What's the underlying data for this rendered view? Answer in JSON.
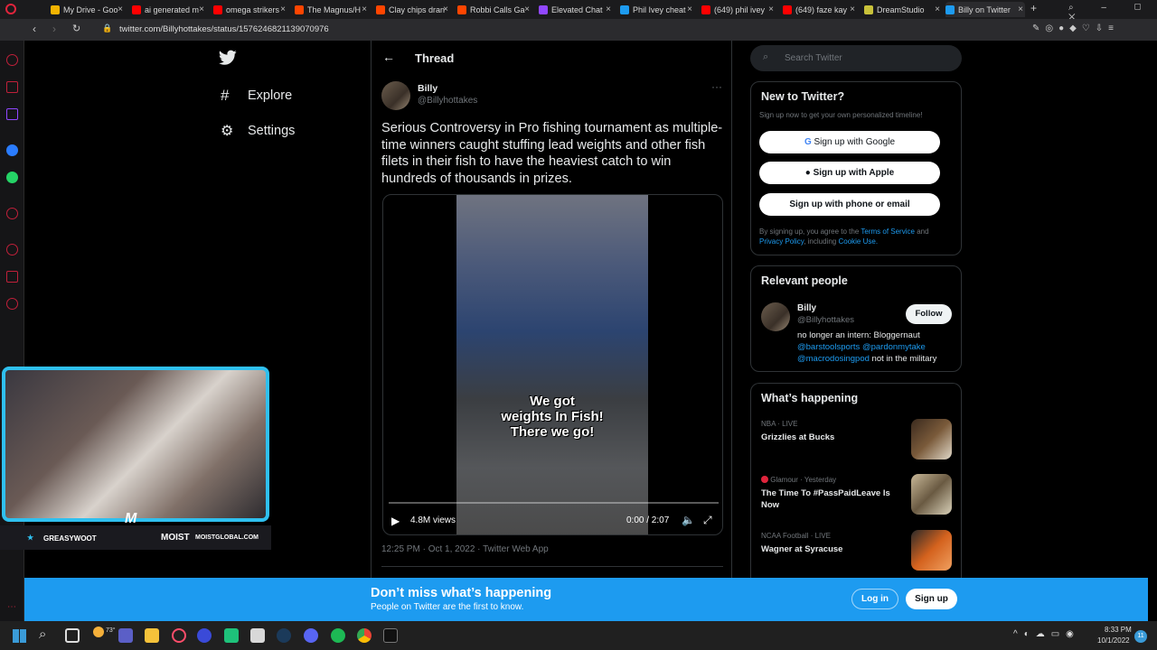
{
  "browser": {
    "tabs": [
      {
        "label": "My Drive - Goo",
        "color": "#f4b400"
      },
      {
        "label": "ai generated m",
        "color": "#ff0000"
      },
      {
        "label": "omega strikers",
        "color": "#ff0000"
      },
      {
        "label": "The Magnus/H",
        "color": "#ff4500"
      },
      {
        "label": "Clay chips dran",
        "color": "#ff4500"
      },
      {
        "label": "Robbi Calls Ga",
        "color": "#ff4500"
      },
      {
        "label": "Elevated Chat",
        "color": "#9147ff"
      },
      {
        "label": "Phil Ivey cheat",
        "color": "#1d9bf0"
      },
      {
        "label": "(649) phil ivey",
        "color": "#ff0000"
      },
      {
        "label": "(649) faze kay",
        "color": "#ff0000"
      },
      {
        "label": "DreamStudio",
        "color": "#c9c23a"
      },
      {
        "label": "Billy on Twitter",
        "color": "#1d9bf0"
      }
    ],
    "url": "twitter.com/Billyhottakes/status/1576246821139070976"
  },
  "nav": {
    "explore": "Explore",
    "settings": "Settings"
  },
  "thread": {
    "title": "Thread",
    "author_name": "Billy",
    "author_handle": "@Billyhottakes",
    "text": "Serious Controversy in Pro fishing tournament as multiple-time winners caught stuffing lead weights and other fish filets in their fish to have the heaviest catch to win hundreds of thousands in prizes.",
    "video": {
      "caption_line1": "We got",
      "caption_line2": "weights In Fish!",
      "caption_line3": "There we go!",
      "views": "4.8M views",
      "time": "0:00 / 2:07",
      "progress_fraction": 0
    },
    "timestamp": "12:25 PM · Oct 1, 2022 · Twitter Web App"
  },
  "sidebar_right": {
    "search_placeholder": "Search Twitter",
    "new_to_twitter": {
      "title": "New to Twitter?",
      "subtitle": "Sign up now to get your own personalized timeline!",
      "google": "Sign up with Google",
      "apple": "Sign up with Apple",
      "phone": "Sign up with phone or email",
      "legal_prefix": "By signing up, you agree to the",
      "terms": "Terms of Service",
      "and": "and",
      "privacy": "Privacy Policy",
      "including": ", including",
      "cookie": "Cookie Use."
    },
    "relevant_people": {
      "title": "Relevant people",
      "name": "Billy",
      "handle": "@Billyhottakes",
      "follow": "Follow",
      "bio_text": "no longer an intern: Bloggernaut",
      "bio_link1": "@barstoolsports",
      "bio_link2": "@pardonmytake",
      "bio_link3": "@macrodosingpod",
      "bio_tail": "not in the military"
    },
    "whats_happening": {
      "title": "What’s happening",
      "trends": [
        {
          "meta": "NBA · LIVE",
          "title": "Grizzlies at Bucks",
          "thumb": "#7a5a3a"
        },
        {
          "meta": "Glamour · Yesterday",
          "title": "The Time To #PassPaidLeave Is Now",
          "thumb": "#9a8a6a"
        },
        {
          "meta": "NCAA Football · LIVE",
          "title": "Wagner at Syracuse",
          "thumb": "#d4621e"
        }
      ]
    }
  },
  "banner": {
    "title": "Don’t miss what’s happening",
    "subtitle": "People on Twitter are the first to know.",
    "login": "Log in",
    "signup": "Sign up"
  },
  "webcam": {
    "left_name": "GREASYWOOT",
    "brand": "MOIST",
    "site": "MOISTGLOBAL.COM"
  },
  "taskbar": {
    "weather": "73°",
    "time": "8:33 PM",
    "date": "10/1/2022",
    "notifications": "11"
  }
}
